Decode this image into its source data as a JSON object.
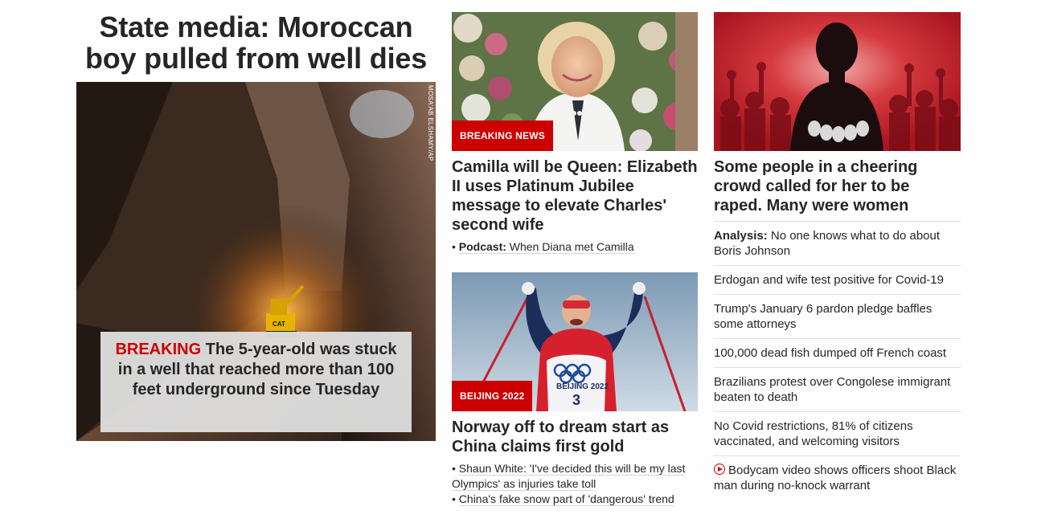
{
  "lead": {
    "headline": "State media: Moroccan boy pulled from well dies",
    "photo_credit": "MOSA'AB ELSHAMY/AP",
    "caption_breaking": "BREAKING",
    "caption_text": " The 5-year-old was stuck in a well that reached more than 100 feet underground since Tuesday"
  },
  "camilla": {
    "badge": "BREAKING NEWS",
    "headline": "Camilla will be Queen: Elizabeth II uses Platinum Jubilee message to elevate Charles' second wife",
    "sub_prefix": "Podcast:",
    "sub_text": " When Diana met Camilla"
  },
  "norway": {
    "badge": "BEIJING 2022",
    "headline": "Norway off to dream start as China claims first gold",
    "sub_links": [
      "Shaun White: 'I've decided this will be my last Olympics' as injuries take toll",
      "China's fake snow part of 'dangerous' trend"
    ]
  },
  "crowd": {
    "headline": "Some people in a cheering crowd called for her to be raped. Many were women"
  },
  "list": {
    "items": [
      {
        "prefix": "Analysis:",
        "text": " No one knows what to do about Boris Johnson"
      },
      {
        "prefix": "",
        "text": "Erdogan and wife test positive for Covid-19"
      },
      {
        "prefix": "",
        "text": "Trump's January 6 pardon pledge baffles some attorneys"
      },
      {
        "prefix": "",
        "text": "100,000 dead fish dumped off French coast"
      },
      {
        "prefix": "",
        "text": "Brazilians protest over Congolese immigrant beaten to death"
      },
      {
        "prefix": "",
        "text": "No Covid restrictions, 81% of citizens vaccinated, and welcoming visitors"
      },
      {
        "prefix": "",
        "text": "Bodycam video shows officers shoot Black man during no-knock warrant",
        "icon": "play-icon"
      }
    ]
  },
  "colors": {
    "accent": "#cc0000",
    "text": "#262626",
    "divider": "#e0e0e0"
  }
}
